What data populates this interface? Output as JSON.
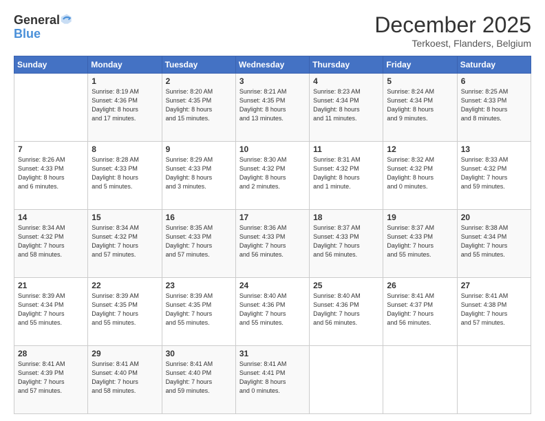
{
  "header": {
    "logo_general": "General",
    "logo_blue": "Blue",
    "month": "December 2025",
    "location": "Terkoest, Flanders, Belgium"
  },
  "weekdays": [
    "Sunday",
    "Monday",
    "Tuesday",
    "Wednesday",
    "Thursday",
    "Friday",
    "Saturday"
  ],
  "weeks": [
    [
      {
        "day": "",
        "info": ""
      },
      {
        "day": "1",
        "info": "Sunrise: 8:19 AM\nSunset: 4:36 PM\nDaylight: 8 hours\nand 17 minutes."
      },
      {
        "day": "2",
        "info": "Sunrise: 8:20 AM\nSunset: 4:35 PM\nDaylight: 8 hours\nand 15 minutes."
      },
      {
        "day": "3",
        "info": "Sunrise: 8:21 AM\nSunset: 4:35 PM\nDaylight: 8 hours\nand 13 minutes."
      },
      {
        "day": "4",
        "info": "Sunrise: 8:23 AM\nSunset: 4:34 PM\nDaylight: 8 hours\nand 11 minutes."
      },
      {
        "day": "5",
        "info": "Sunrise: 8:24 AM\nSunset: 4:34 PM\nDaylight: 8 hours\nand 9 minutes."
      },
      {
        "day": "6",
        "info": "Sunrise: 8:25 AM\nSunset: 4:33 PM\nDaylight: 8 hours\nand 8 minutes."
      }
    ],
    [
      {
        "day": "7",
        "info": "Sunrise: 8:26 AM\nSunset: 4:33 PM\nDaylight: 8 hours\nand 6 minutes."
      },
      {
        "day": "8",
        "info": "Sunrise: 8:28 AM\nSunset: 4:33 PM\nDaylight: 8 hours\nand 5 minutes."
      },
      {
        "day": "9",
        "info": "Sunrise: 8:29 AM\nSunset: 4:33 PM\nDaylight: 8 hours\nand 3 minutes."
      },
      {
        "day": "10",
        "info": "Sunrise: 8:30 AM\nSunset: 4:32 PM\nDaylight: 8 hours\nand 2 minutes."
      },
      {
        "day": "11",
        "info": "Sunrise: 8:31 AM\nSunset: 4:32 PM\nDaylight: 8 hours\nand 1 minute."
      },
      {
        "day": "12",
        "info": "Sunrise: 8:32 AM\nSunset: 4:32 PM\nDaylight: 8 hours\nand 0 minutes."
      },
      {
        "day": "13",
        "info": "Sunrise: 8:33 AM\nSunset: 4:32 PM\nDaylight: 7 hours\nand 59 minutes."
      }
    ],
    [
      {
        "day": "14",
        "info": "Sunrise: 8:34 AM\nSunset: 4:32 PM\nDaylight: 7 hours\nand 58 minutes."
      },
      {
        "day": "15",
        "info": "Sunrise: 8:34 AM\nSunset: 4:32 PM\nDaylight: 7 hours\nand 57 minutes."
      },
      {
        "day": "16",
        "info": "Sunrise: 8:35 AM\nSunset: 4:33 PM\nDaylight: 7 hours\nand 57 minutes."
      },
      {
        "day": "17",
        "info": "Sunrise: 8:36 AM\nSunset: 4:33 PM\nDaylight: 7 hours\nand 56 minutes."
      },
      {
        "day": "18",
        "info": "Sunrise: 8:37 AM\nSunset: 4:33 PM\nDaylight: 7 hours\nand 56 minutes."
      },
      {
        "day": "19",
        "info": "Sunrise: 8:37 AM\nSunset: 4:33 PM\nDaylight: 7 hours\nand 55 minutes."
      },
      {
        "day": "20",
        "info": "Sunrise: 8:38 AM\nSunset: 4:34 PM\nDaylight: 7 hours\nand 55 minutes."
      }
    ],
    [
      {
        "day": "21",
        "info": "Sunrise: 8:39 AM\nSunset: 4:34 PM\nDaylight: 7 hours\nand 55 minutes."
      },
      {
        "day": "22",
        "info": "Sunrise: 8:39 AM\nSunset: 4:35 PM\nDaylight: 7 hours\nand 55 minutes."
      },
      {
        "day": "23",
        "info": "Sunrise: 8:39 AM\nSunset: 4:35 PM\nDaylight: 7 hours\nand 55 minutes."
      },
      {
        "day": "24",
        "info": "Sunrise: 8:40 AM\nSunset: 4:36 PM\nDaylight: 7 hours\nand 55 minutes."
      },
      {
        "day": "25",
        "info": "Sunrise: 8:40 AM\nSunset: 4:36 PM\nDaylight: 7 hours\nand 56 minutes."
      },
      {
        "day": "26",
        "info": "Sunrise: 8:41 AM\nSunset: 4:37 PM\nDaylight: 7 hours\nand 56 minutes."
      },
      {
        "day": "27",
        "info": "Sunrise: 8:41 AM\nSunset: 4:38 PM\nDaylight: 7 hours\nand 57 minutes."
      }
    ],
    [
      {
        "day": "28",
        "info": "Sunrise: 8:41 AM\nSunset: 4:39 PM\nDaylight: 7 hours\nand 57 minutes."
      },
      {
        "day": "29",
        "info": "Sunrise: 8:41 AM\nSunset: 4:40 PM\nDaylight: 7 hours\nand 58 minutes."
      },
      {
        "day": "30",
        "info": "Sunrise: 8:41 AM\nSunset: 4:40 PM\nDaylight: 7 hours\nand 59 minutes."
      },
      {
        "day": "31",
        "info": "Sunrise: 8:41 AM\nSunset: 4:41 PM\nDaylight: 8 hours\nand 0 minutes."
      },
      {
        "day": "",
        "info": ""
      },
      {
        "day": "",
        "info": ""
      },
      {
        "day": "",
        "info": ""
      }
    ]
  ]
}
